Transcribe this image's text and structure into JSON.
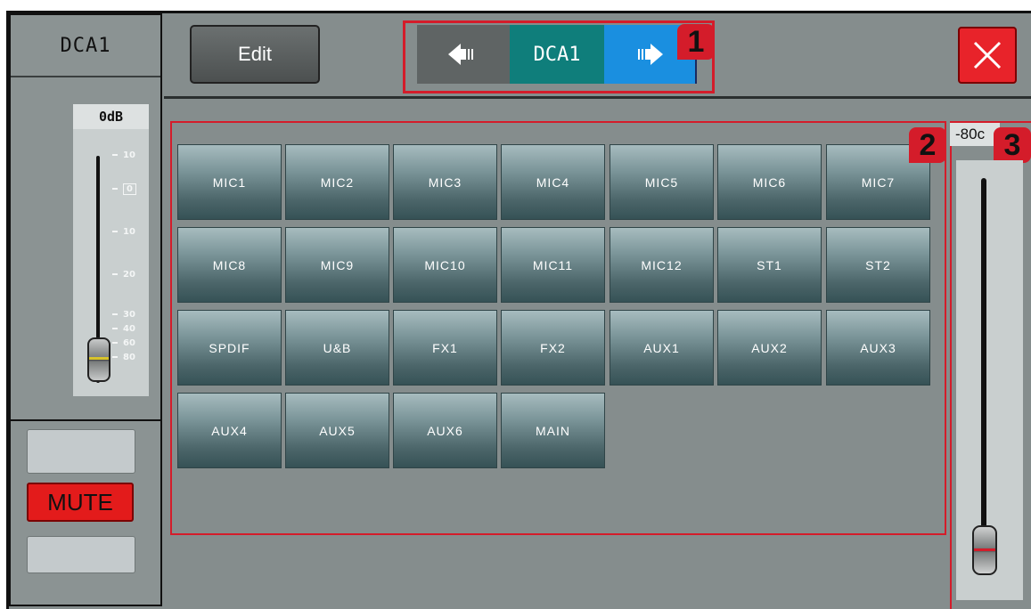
{
  "strip": {
    "title": "DCA1",
    "gain_readout": "0dB",
    "scale": [
      "10",
      "0",
      "10",
      "20",
      "30",
      "40",
      "60",
      "80"
    ],
    "mute_label": "MUTE"
  },
  "toolbar": {
    "edit_label": "Edit",
    "current_dca": "DCA1",
    "prev_icon": "arrow-left-icon",
    "next_icon": "arrow-right-icon",
    "close_icon": "close-icon"
  },
  "channels": [
    "MIC1",
    "MIC2",
    "MIC3",
    "MIC4",
    "MIC5",
    "MIC6",
    "MIC7",
    "MIC8",
    "MIC9",
    "MIC10",
    "MIC11",
    "MIC12",
    "ST1",
    "ST2",
    "SPDIF",
    "U&B",
    "FX1",
    "FX2",
    "AUX1",
    "AUX2",
    "AUX3",
    "AUX4",
    "AUX5",
    "AUX6",
    "MAIN"
  ],
  "fader": {
    "readout": "-80c"
  },
  "callouts": [
    "1",
    "2",
    "3"
  ],
  "colors": {
    "accent_teal": "#0f7e7b",
    "accent_blue": "#1a8fe0",
    "mute_red": "#e31b1b",
    "callout_red": "#d41c2a"
  }
}
